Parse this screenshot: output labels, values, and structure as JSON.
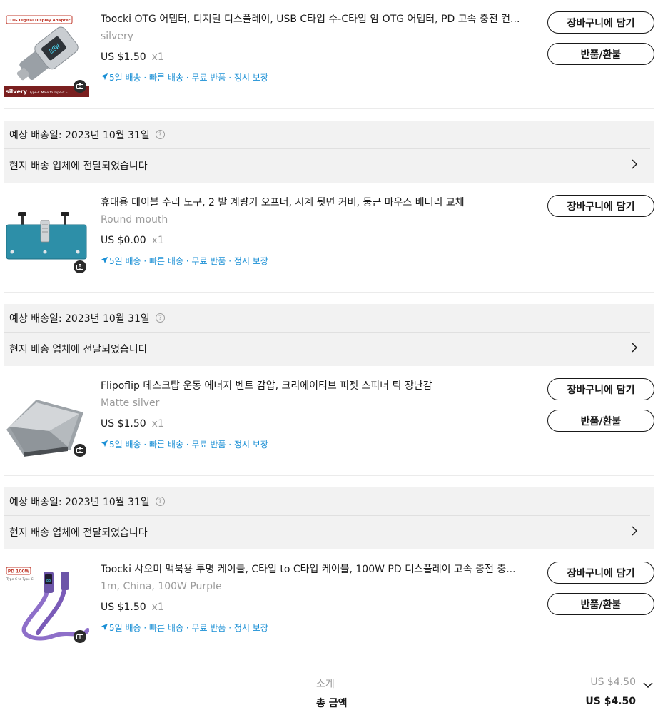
{
  "items": [
    {
      "title": "Toocki OTG 어댑터, 디지털 디스플레이, USB C타입 수-C타입 암 OTG 어댑터, PD 고속 충전 컨...",
      "variant": "silvery",
      "price": "US $1.50",
      "qty": "x1",
      "shipping": "5일 배송 · 빠른 배송 · 무료 반품 · 정시 보장",
      "image_label_top": "OTG Digital Display Adapter",
      "image_label_bottom": "silvery",
      "image_label_sub": "Type-C Male to Type-C F",
      "buttons": [
        "장바구니에 담기",
        "반품/환불"
      ]
    },
    {
      "title": "휴대용 테이블 수리 도구, 2 발 계량기 오프너, 시계 뒷면 커버, 둥근 마우스 배터리 교체",
      "variant": "Round mouth",
      "price": "US $0.00",
      "qty": "x1",
      "shipping": "5일 배송 · 빠른 배송 · 무료 반품 · 정시 보장",
      "buttons": [
        "장바구니에 담기"
      ]
    },
    {
      "title": "Flipoflip 데스크탑 운동 에너지 벤트 감압, 크리에이티브 피젯 스피너 틱 장난감",
      "variant": "Matte silver",
      "price": "US $1.50",
      "qty": "x1",
      "shipping": "5일 배송 · 빠른 배송 · 무료 반품 · 정시 보장",
      "buttons": [
        "장바구니에 담기",
        "반품/환불"
      ]
    },
    {
      "title": "Toocki 샤오미 맥북용 투명 케이블, C타입 to C타입 케이블, 100W PD 디스플레이 고속 충전 충...",
      "variant": "1m, China, 100W Purple",
      "price": "US $1.50",
      "qty": "x1",
      "shipping": "5일 배송 · 빠른 배송 · 무료 반품 · 정시 보장",
      "image_label_top": "PD 100W",
      "image_label_sub": "Type-C to Type-C",
      "buttons": [
        "장바구니에 담기",
        "반품/환불"
      ]
    }
  ],
  "deliveries": [
    {
      "date": "예상 배송일: 2023년 10월 31일",
      "status": "현지 배송 업체에 전달되었습니다"
    },
    {
      "date": "예상 배송일: 2023년 10월 31일",
      "status": "현지 배송 업체에 전달되었습니다"
    },
    {
      "date": "예상 배송일: 2023년 10월 31일",
      "status": "현지 배송 업체에 전달되었습니다"
    }
  ],
  "summary": {
    "subtotal_label": "소계",
    "subtotal_value": "US $4.50",
    "total_label": "총 금액",
    "total_value": "US $4.50"
  },
  "colors": {
    "shipping_text": "#1a8fd5",
    "delivery_bg": "#f2f2f2",
    "muted_text": "#9b9b9b"
  },
  "icons": [
    "camera-icon",
    "plane-icon",
    "help-icon",
    "chevron-right-icon",
    "chevron-down-icon"
  ]
}
